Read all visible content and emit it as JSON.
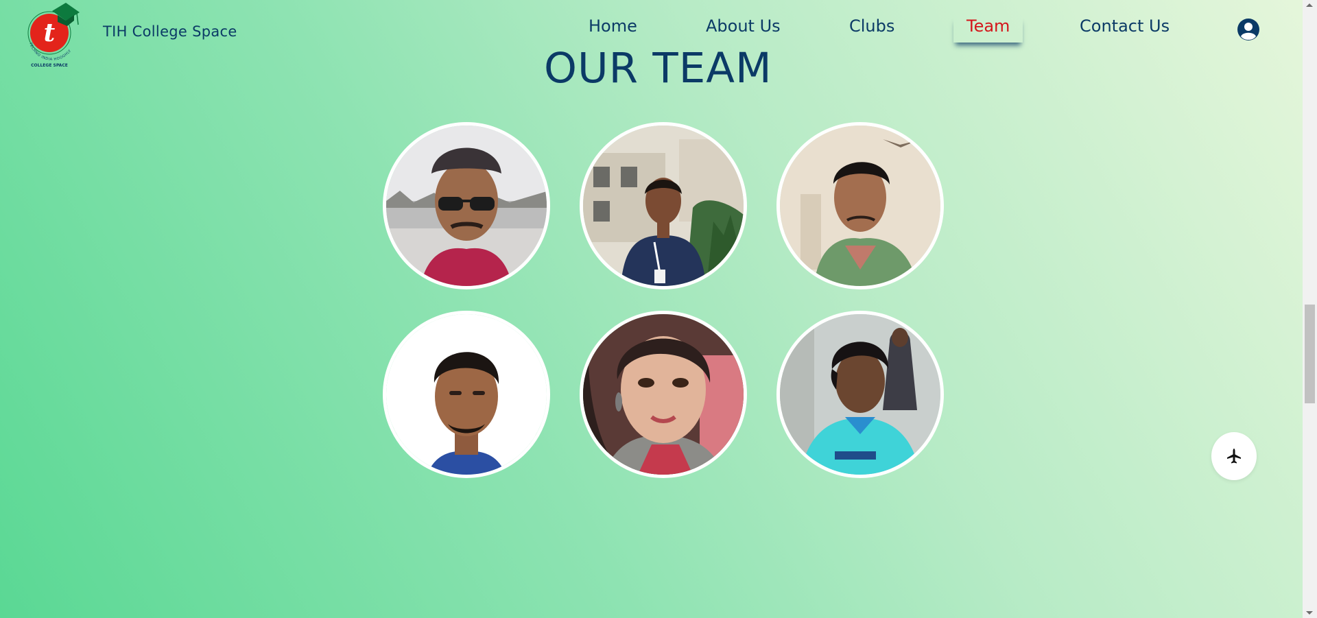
{
  "header": {
    "brand": "TIH College Space",
    "logo_ring_text": "TECHNO INDIA HOOGHLY",
    "logo_sub_text": "COLLEGE SPACE",
    "logo_mark": "t",
    "nav": [
      "Home",
      "About Us",
      "Clubs",
      "Team",
      "Contact Us"
    ],
    "active_nav": "Team",
    "user_icon": "user-circle-icon"
  },
  "main": {
    "title": "OUR TEAM",
    "members": [
      {
        "photo": "member-1-photo"
      },
      {
        "photo": "member-2-photo"
      },
      {
        "photo": "member-3-photo"
      },
      {
        "photo": "member-4-photo"
      },
      {
        "photo": "member-5-photo"
      },
      {
        "photo": "member-6-photo"
      }
    ]
  },
  "floating_button": {
    "icon": "airplane-icon"
  },
  "colors": {
    "primary": "#0b3a66",
    "active": "#d4161b",
    "gradient_start": "#5ad894",
    "gradient_end": "#e6f6db",
    "logo_red": "#e3241b",
    "logo_green": "#0d7a3e"
  }
}
